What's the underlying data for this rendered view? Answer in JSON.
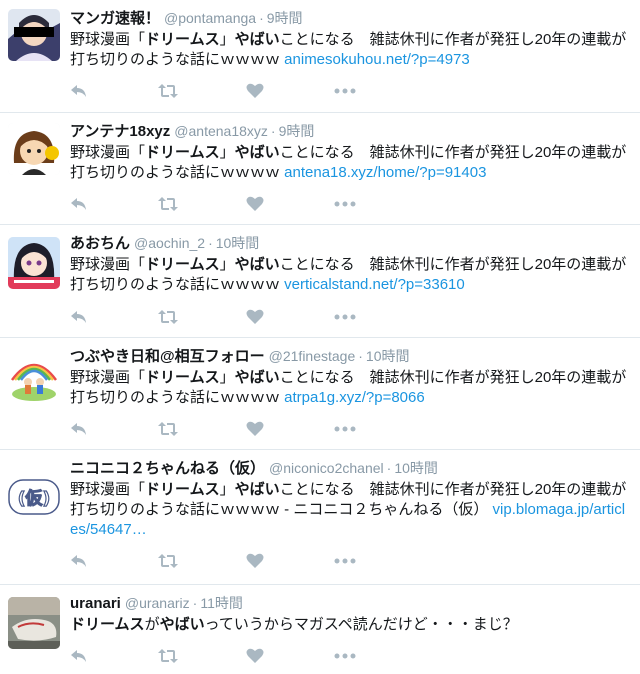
{
  "colors": {
    "link": "#1b95e0",
    "muted": "#8899a6",
    "icon": "#aab8c2",
    "divider": "#e1e8ed"
  },
  "icons": {
    "reply": "reply-icon",
    "retweet": "retweet-icon",
    "like": "heart-icon",
    "more": "more-icon"
  },
  "tweets": [
    {
      "name": "マンガ速報！",
      "handle": "@pontamanga",
      "dot": "·",
      "time": "9時間",
      "avatar": "avatar-pontamanga",
      "t1": "野球漫画「",
      "s1": "ドリームス",
      "t2": "」",
      "s2": "やばい",
      "t3": "ことになる　雑誌休刊に作者が発狂し20年の連載が打ち切りのような話にｗｗｗｗ ",
      "link": "animesokuhou.net/?p=4973"
    },
    {
      "name": "アンテナ18xyz",
      "handle": "@antena18xyz",
      "dot": "·",
      "time": "9時間",
      "avatar": "avatar-antena18xyz",
      "t1": "野球漫画「",
      "s1": "ドリームス",
      "t2": "」",
      "s2": "やばい",
      "t3": "ことになる　雑誌休刊に作者が発狂し20年の連載が打ち切りのような話にｗｗｗｗ ",
      "link": "antena18.xyz/home/?p=91403"
    },
    {
      "name": "あおちん",
      "handle": "@aochin_2",
      "dot": "·",
      "time": "10時間",
      "avatar": "avatar-aochin",
      "t1": "野球漫画「",
      "s1": "ドリームス",
      "t2": "」",
      "s2": "やばい",
      "t3": "ことになる　雑誌休刊に作者が発狂し20年の連載が打ち切りのような話にｗｗｗｗ ",
      "link": "verticalstand.net/?p=33610"
    },
    {
      "name": "つぶやき日和@相互フォロー",
      "handle": "@21finestage",
      "dot": "·",
      "time": "10時間",
      "avatar": "avatar-21finestage",
      "t1": "野球漫画「",
      "s1": "ドリームス",
      "t2": "」",
      "s2": "やばい",
      "t3": "ことになる　雑誌休刊に作者が発狂し20年の連載が打ち切りのような話にｗｗｗｗ ",
      "link": "atrpa1g.xyz/?p=8066"
    },
    {
      "name": "ニコニコ２ちゃんねる（仮）",
      "handle": "@niconico2chanel",
      "dot": "·",
      "time": "10時間",
      "avatar": "avatar-niconico2chanel",
      "avatar_text": "(仮)",
      "t1": "野球漫画「",
      "s1": "ドリームス",
      "t2": "」",
      "s2": "やばい",
      "t3": "ことになる　雑誌休刊に作者が発狂し20年の連載が打ち切りのような話にｗｗｗｗ - ニコニコ２ちゃんねる（仮） ",
      "link": "vip.blomaga.jp/articles/54647…"
    },
    {
      "name": "uranari",
      "handle": "@uranariz",
      "dot": "·",
      "time": "11時間",
      "avatar": "avatar-uranari",
      "t1": "",
      "s1": "ドリームス",
      "t2": "が",
      "s2": "やばい",
      "t3": "っていうからマガスペ読んだけど・・・まじ？",
      "link": ""
    }
  ]
}
